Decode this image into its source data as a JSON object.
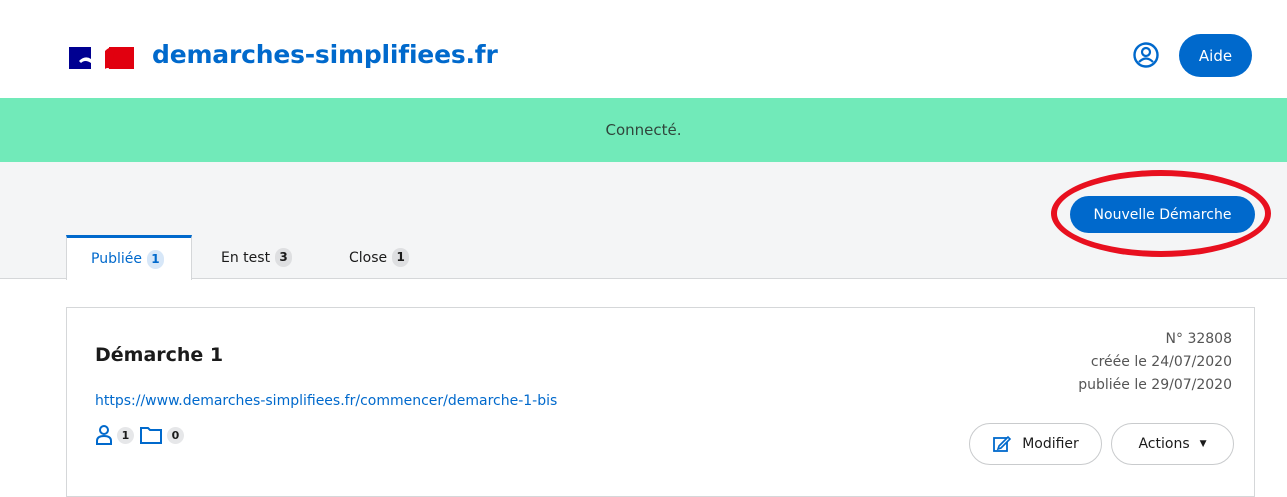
{
  "header": {
    "brand": "demarches-simplifiees.fr",
    "help_label": "Aide",
    "user_icon": "user-circle-icon"
  },
  "flash": {
    "message": "Connecté."
  },
  "toolbar": {
    "new_label": "Nouvelle Démarche"
  },
  "tabs": [
    {
      "label": "Publiée",
      "count": "1"
    },
    {
      "label": "En test",
      "count": "3"
    },
    {
      "label": "Close",
      "count": "1"
    }
  ],
  "card": {
    "title": "Démarche 1",
    "link": "https://www.demarches-simplifiees.fr/commencer/demarche-1-bis",
    "instructeurs_count": "1",
    "dossiers_count": "0",
    "number": "N° 32808",
    "created": "créée le 24/07/2020",
    "published": "publiée le 29/07/2020",
    "edit_label": "Modifier",
    "actions_label": "Actions"
  },
  "colors": {
    "accent": "#0069cc",
    "flash": "#71eab9",
    "highlight": "#e8101f"
  }
}
